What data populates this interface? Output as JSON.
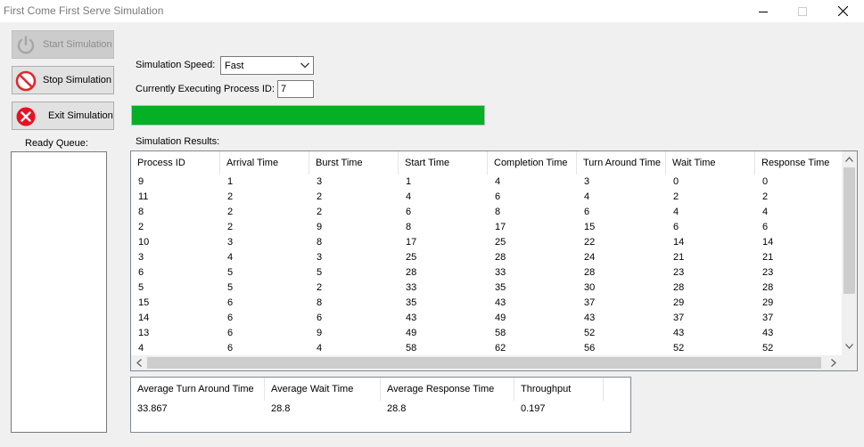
{
  "window": {
    "title": "First Come First Serve Simulation"
  },
  "buttons": {
    "start": "Start Simulation",
    "stop": "Stop Simulation",
    "exit": "Exit Simulation"
  },
  "labels": {
    "ready_queue": "Ready Queue:",
    "speed": "Simulation Speed:",
    "pid": "Currently Executing Process ID:",
    "results": "Simulation Results:"
  },
  "speed": {
    "value": "Fast"
  },
  "current_pid": "7",
  "progress": {
    "percent": 100,
    "color": "#06b025"
  },
  "results_table": {
    "columns": [
      "Process ID",
      "Arrival Time",
      "Burst Time",
      "Start Time",
      "Completion Time",
      "Turn Around Time",
      "Wait Time",
      "Response Time"
    ],
    "rows": [
      [
        "9",
        "1",
        "3",
        "1",
        "4",
        "3",
        "0",
        "0"
      ],
      [
        "11",
        "2",
        "2",
        "4",
        "6",
        "4",
        "2",
        "2"
      ],
      [
        "8",
        "2",
        "2",
        "6",
        "8",
        "6",
        "4",
        "4"
      ],
      [
        "2",
        "2",
        "9",
        "8",
        "17",
        "15",
        "6",
        "6"
      ],
      [
        "10",
        "3",
        "8",
        "17",
        "25",
        "22",
        "14",
        "14"
      ],
      [
        "3",
        "4",
        "3",
        "25",
        "28",
        "24",
        "21",
        "21"
      ],
      [
        "6",
        "5",
        "5",
        "28",
        "33",
        "28",
        "23",
        "23"
      ],
      [
        "5",
        "5",
        "2",
        "33",
        "35",
        "30",
        "28",
        "28"
      ],
      [
        "15",
        "6",
        "8",
        "35",
        "43",
        "37",
        "29",
        "29"
      ],
      [
        "14",
        "6",
        "6",
        "43",
        "49",
        "43",
        "37",
        "37"
      ],
      [
        "13",
        "6",
        "9",
        "49",
        "58",
        "52",
        "43",
        "43"
      ],
      [
        "4",
        "6",
        "4",
        "58",
        "62",
        "56",
        "52",
        "52"
      ]
    ]
  },
  "averages": {
    "columns": [
      "Average Turn Around Time",
      "Average Wait Time",
      "Average Response Time",
      "Throughput"
    ],
    "values": [
      "33.867",
      "28.8",
      "28.8",
      "0.197"
    ]
  },
  "icons": {
    "start": "power-icon",
    "stop": "no-entry-icon",
    "exit": "red-x-icon"
  }
}
